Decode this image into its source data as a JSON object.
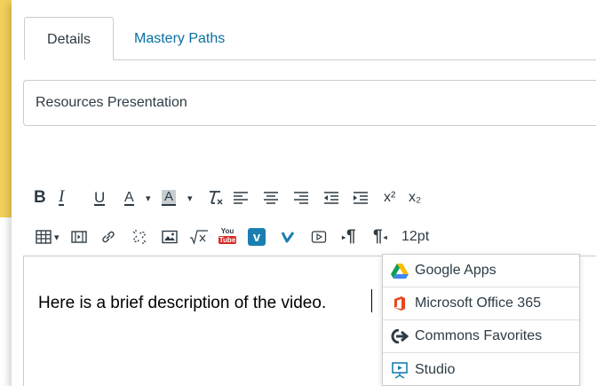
{
  "tabs": {
    "details_label": "Details",
    "mastery_label": "Mastery Paths"
  },
  "title_field": {
    "value": "Resources Presentation"
  },
  "toolbar": {
    "bold": "B",
    "italic": "I",
    "underline": "U",
    "font_color": "A",
    "background_color": "A",
    "dropdown_arrow": "▾",
    "font_size_value": "12pt",
    "youtube_line1": "You",
    "youtube_line2": "Tube",
    "vimeo": "v",
    "paragraph_symbol": "¶",
    "superscript": "x²",
    "subscript": "x₂",
    "icons": [
      "bold-icon",
      "italic-icon",
      "underline-icon",
      "font-color-icon",
      "background-color-icon",
      "clear-formatting-icon",
      "align-left-icon",
      "align-center-icon",
      "align-right-icon",
      "outdent-icon",
      "indent-icon",
      "superscript-icon",
      "subscript-icon",
      "table-icon",
      "media-icon",
      "link-icon",
      "unlink-icon",
      "image-icon",
      "equation-icon",
      "youtube-icon",
      "vimeo-icon",
      "vimeo-outline-icon",
      "video-icon",
      "ltr-paragraph-icon",
      "rtl-paragraph-icon"
    ]
  },
  "editor": {
    "text": "Here is a brief description of the video."
  },
  "dropdown": {
    "items": [
      {
        "label": "Google Apps",
        "icon": "google-drive-icon"
      },
      {
        "label": "Microsoft Office 365",
        "icon": "office-icon"
      },
      {
        "label": "Commons Favorites",
        "icon": "commons-icon"
      },
      {
        "label": "Studio",
        "icon": "studio-icon"
      }
    ]
  },
  "colors": {
    "yellow_background": "#f1d15a",
    "link_blue": "#0770a3",
    "text_dark": "#2d3b45",
    "border": "#c7cdd1"
  }
}
